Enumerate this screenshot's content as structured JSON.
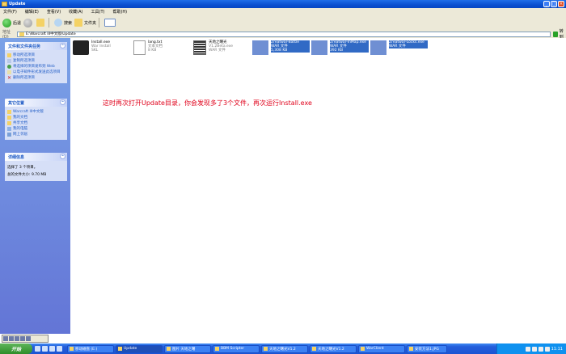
{
  "window": {
    "title": "Update"
  },
  "menu": [
    "文件(F)",
    "编辑(E)",
    "查看(V)",
    "收藏(A)",
    "工具(T)",
    "帮助(H)"
  ],
  "toolbar": {
    "back": "后退",
    "search": "搜索",
    "folders": "文件夹"
  },
  "address": {
    "label": "地址(D)",
    "path": "E:\\Warcraft III中文版\\Update",
    "go": "转到"
  },
  "sidebar": {
    "file_tasks": {
      "title": "文件和文件夹任务",
      "items": [
        "移动所选项目",
        "复制所选项目",
        "将选择的项目发布到 Web",
        "以电子邮件形式发送此选项目",
        "删除所选项目"
      ]
    },
    "other_places": {
      "title": "其它位置",
      "items": [
        "Warcraft III中文版",
        "我的文档",
        "共享文档",
        "我的电脑",
        "网上邻居"
      ]
    },
    "details": {
      "title": "详细信息",
      "selected": "选择了 3 个项目。",
      "size": "总的文件大小: 9.70 MB"
    }
  },
  "files": [
    {
      "name": "Install.exe",
      "meta1": "War Install",
      "meta2": "SKL",
      "selected": false
    },
    {
      "name": "lang.txt",
      "meta1": "文本文档",
      "meta2": "8 KB",
      "selected": false
    },
    {
      "name": "天地之曙光",
      "meta1": "V1.2Beta.exe",
      "meta2": "WAR 文件",
      "selected": false
    },
    {
      "name": "Zreatwar-Battle",
      "meta1": "WAR 文件",
      "meta2": "5,308 KB",
      "selected": true
    },
    {
      "name": "Zreatwar-InMap.exe",
      "meta1": "WAR 文件",
      "meta2": "392 KB",
      "selected": true
    },
    {
      "name": "Zreatwar-Locks.exe",
      "meta1": "WAR 文件",
      "meta2": "",
      "selected": true
    }
  ],
  "annotation": "这时再次打开Update目录，你会发现多了3个文件，再次运行Install.exe",
  "taskbar": {
    "start": "开始",
    "tasks": [
      "移动磁盘 (E:)",
      "Update",
      "图片 天地之曙",
      "BBM Scripter",
      "天地之曙光V1.2",
      "天地之曙光V1.2",
      "WarClient",
      "安装方法1.JPG"
    ],
    "clock": "11:11"
  },
  "colors": {
    "titlebar": "#0a4fd0",
    "selection": "#316ac5",
    "annotation": "#e0001a"
  }
}
